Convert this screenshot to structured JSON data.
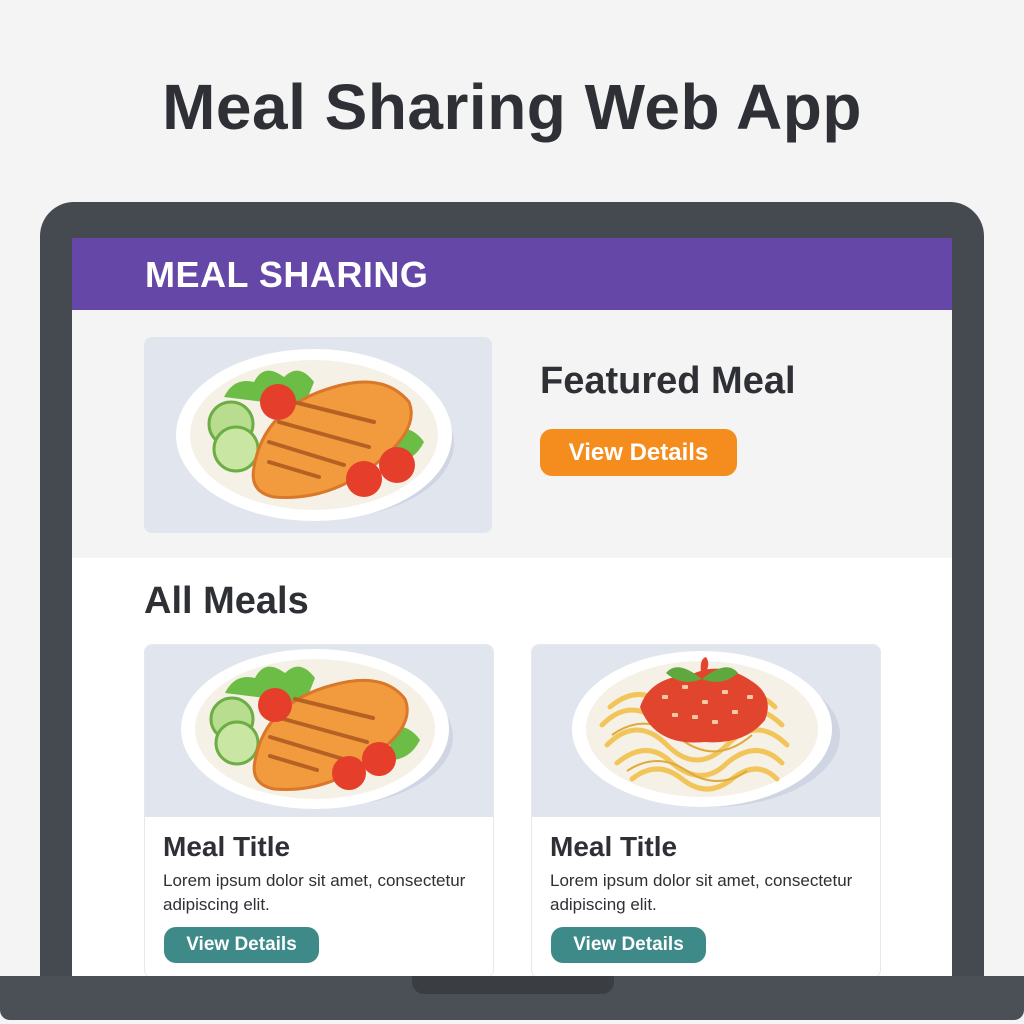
{
  "page": {
    "heading": "Meal Sharing Web App"
  },
  "app": {
    "brand": "MEAL SHARING"
  },
  "hero": {
    "title": "Featured Meal",
    "button_label": "View Details",
    "image_icon": "grilled-chicken-plate-icon"
  },
  "meals_section": {
    "title": "All Meals",
    "cards": [
      {
        "title": "Meal Title",
        "description": "Lorem ipsum dolor sit amet, consectetur adipiscing elit.",
        "button_label": "View Details",
        "image_icon": "grilled-chicken-plate-icon"
      },
      {
        "title": "Meal Title",
        "description": "Lorem ipsum dolor sit amet, consectetur adipiscing elit.",
        "button_label": "View Details",
        "image_icon": "spaghetti-plate-icon"
      }
    ]
  },
  "colors": {
    "header": "#6447a6",
    "accent_orange": "#f48c1e",
    "accent_teal": "#3d8a88",
    "laptop_frame": "#454a50"
  }
}
